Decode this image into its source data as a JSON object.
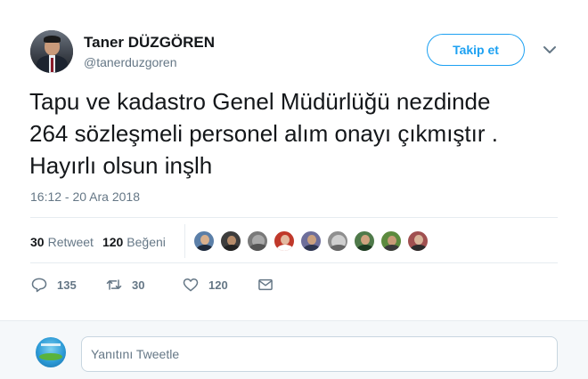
{
  "author": {
    "name": "Taner DÜZGÖREN",
    "handle": "@tanerduzgoren"
  },
  "follow_label": "Takip et",
  "tweet_text": "Tapu ve kadastro Genel Müdürlüğü nezdinde\n264 sözleşmeli personel alım onayı çıkmıştır .\nHayırlı olsun inşlh",
  "timestamp": "16:12 - 20 Ara 2018",
  "stats": {
    "retweet_count": "30",
    "retweet_label": "Retweet",
    "like_count": "120",
    "like_label": "Beğeni"
  },
  "likers": [
    {
      "icon": "liker-avatar",
      "color": "#5b7fa8"
    },
    {
      "icon": "liker-avatar",
      "color": "#3d3d3d"
    },
    {
      "icon": "liker-avatar",
      "color": "#7a7a7a"
    },
    {
      "icon": "liker-avatar",
      "color": "#c0392b"
    },
    {
      "icon": "liker-avatar",
      "color": "#6d6e9a"
    },
    {
      "icon": "liker-avatar",
      "color": "#8f8f8f"
    },
    {
      "icon": "liker-avatar",
      "color": "#4f7a4a"
    },
    {
      "icon": "liker-avatar",
      "color": "#5c8a3e"
    },
    {
      "icon": "liker-avatar",
      "color": "#a05050"
    }
  ],
  "actions": {
    "reply_count": "135",
    "retweet_count": "30",
    "like_count": "120"
  },
  "reply": {
    "placeholder": "Yanıtını Tweetle"
  },
  "colors": {
    "accent": "#1da1f2",
    "secondary_text": "#657786",
    "divider": "#e6ecf0"
  }
}
